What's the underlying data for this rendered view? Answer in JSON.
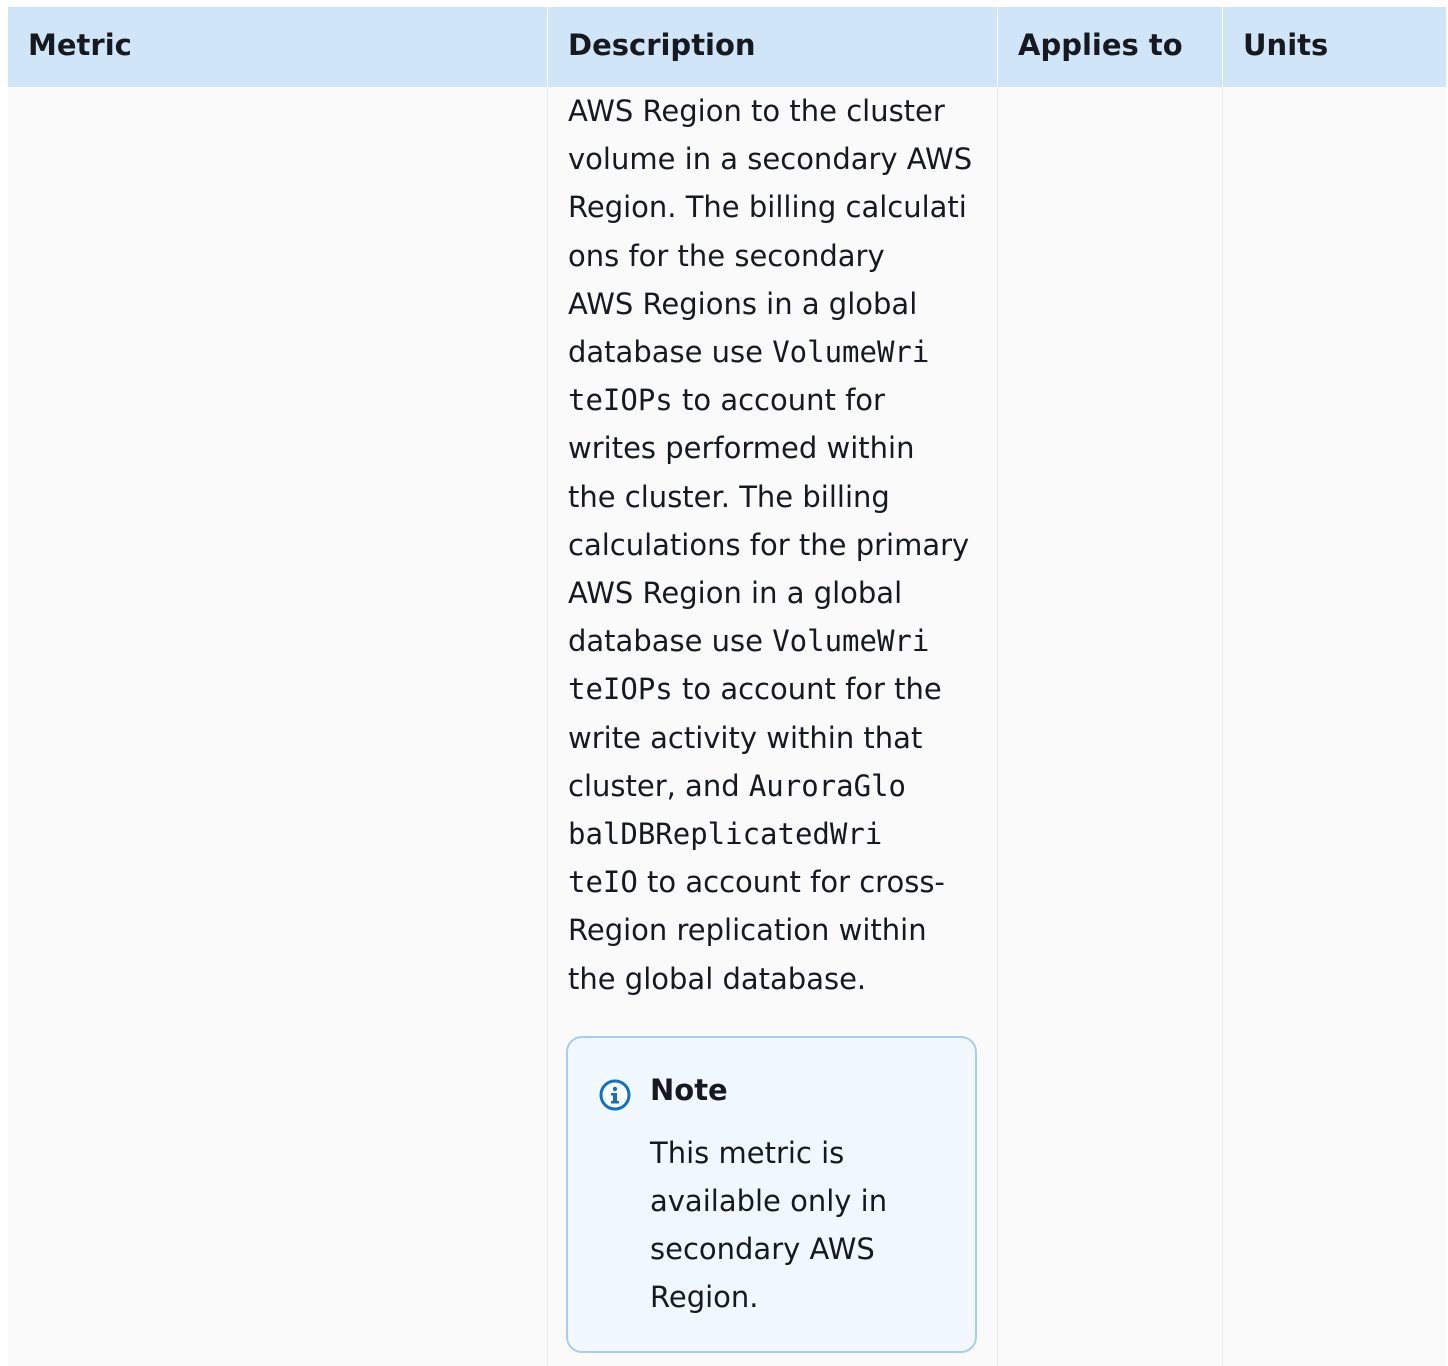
{
  "table": {
    "headers": {
      "metric": "Metric",
      "description": "Description",
      "applies_to": "Applies to",
      "units": "Units"
    },
    "row": {
      "metric": "",
      "applies_to": "",
      "units": "",
      "description_lines": [
        "AWS Region to the cluster",
        "volume in a secondary AWS",
        "Region. The billing calculati",
        "ons for the secondary",
        "AWS Regions in a global",
        "database use ",
        "VolumeWri",
        "teIOPs",
        " to account for",
        "writes performed within",
        "the cluster. The billing",
        "calculations for the primary",
        "AWS Region in a global",
        "database use ",
        "VolumeWri",
        "teIOPs",
        " to account for the",
        "write activity within that",
        "cluster, and ",
        "AuroraGlo",
        "balDBReplicatedWri",
        "teIO",
        " to account for cross-",
        "Region replication within",
        "the global database."
      ],
      "note": {
        "icon": "info-icon",
        "title": "Note",
        "body_lines": [
          "This metric is",
          "available only in",
          "secondary AWS",
          "Region."
        ]
      }
    }
  }
}
